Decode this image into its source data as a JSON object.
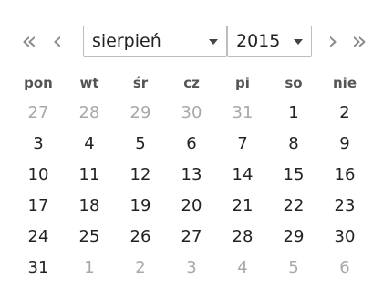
{
  "nav": {
    "prev_year": "«",
    "prev_month": "‹",
    "next_month": "›",
    "next_year": "»"
  },
  "month_select": {
    "value": "sierpień"
  },
  "year_select": {
    "value": "2015"
  },
  "weekdays": [
    "pon",
    "wt",
    "śr",
    "cz",
    "pi",
    "so",
    "nie"
  ],
  "weeks": [
    [
      {
        "d": "27",
        "o": true
      },
      {
        "d": "28",
        "o": true
      },
      {
        "d": "29",
        "o": true
      },
      {
        "d": "30",
        "o": true
      },
      {
        "d": "31",
        "o": true
      },
      {
        "d": "1"
      },
      {
        "d": "2"
      }
    ],
    [
      {
        "d": "3"
      },
      {
        "d": "4"
      },
      {
        "d": "5"
      },
      {
        "d": "6"
      },
      {
        "d": "7",
        "sel": true
      },
      {
        "d": "8"
      },
      {
        "d": "9"
      }
    ],
    [
      {
        "d": "10"
      },
      {
        "d": "11"
      },
      {
        "d": "12"
      },
      {
        "d": "13"
      },
      {
        "d": "14"
      },
      {
        "d": "15"
      },
      {
        "d": "16"
      }
    ],
    [
      {
        "d": "17"
      },
      {
        "d": "18"
      },
      {
        "d": "19"
      },
      {
        "d": "20"
      },
      {
        "d": "21"
      },
      {
        "d": "22"
      },
      {
        "d": "23"
      }
    ],
    [
      {
        "d": "24"
      },
      {
        "d": "25"
      },
      {
        "d": "26"
      },
      {
        "d": "27"
      },
      {
        "d": "28"
      },
      {
        "d": "29"
      },
      {
        "d": "30"
      }
    ],
    [
      {
        "d": "31"
      },
      {
        "d": "1",
        "o": true
      },
      {
        "d": "2",
        "o": true
      },
      {
        "d": "3",
        "o": true
      },
      {
        "d": "4",
        "o": true
      },
      {
        "d": "5",
        "o": true
      },
      {
        "d": "6",
        "o": true
      }
    ]
  ],
  "colors": {
    "selected_bg": "#b8cce4",
    "other_month_text": "#a8a8a8"
  }
}
